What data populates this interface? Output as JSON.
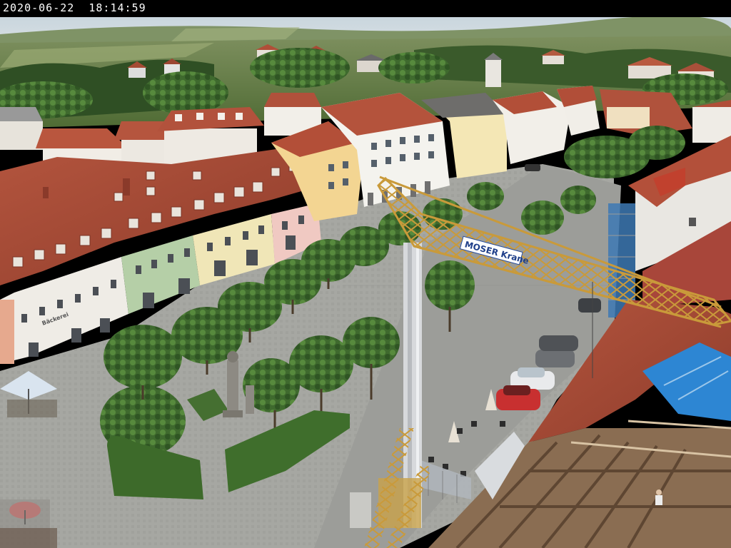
{
  "overlay": {
    "timestamp": "2020-06-22  18:14:59"
  },
  "scene": {
    "crane_banner": "MOSER Krane",
    "shop_signs": [
      "Bäckerei"
    ]
  }
}
